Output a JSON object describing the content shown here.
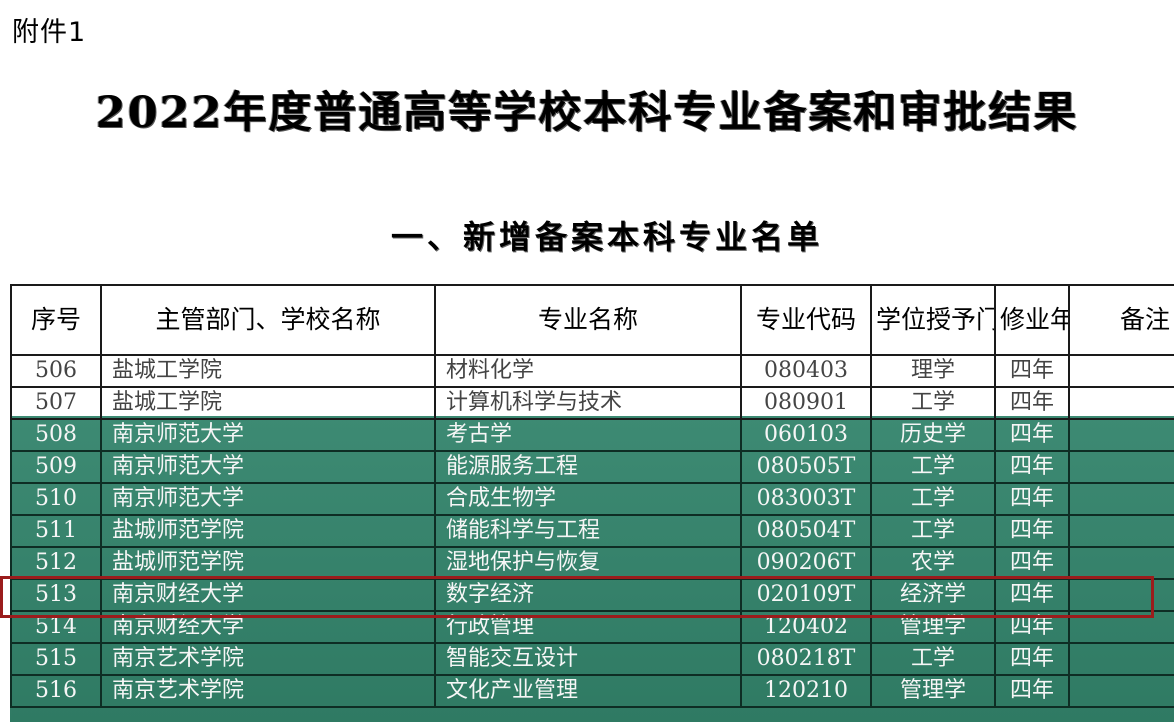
{
  "document": {
    "attachment_label": "附件1",
    "title": "2022年度普通高等学校本科专业备案和审批结果",
    "section_title": "一、新增备案本科专业名单"
  },
  "table": {
    "headers": [
      "序号",
      "主管部门、学校名称",
      "专业名称",
      "专业代码",
      "学位授予门类",
      "修业年限",
      "备注"
    ],
    "rows": [
      {
        "no": "506",
        "school": "盐城工学院",
        "major": "材料化学",
        "code": "080403",
        "degree": "理学",
        "years": "四年",
        "note": ""
      },
      {
        "no": "507",
        "school": "盐城工学院",
        "major": "计算机科学与技术",
        "code": "080901",
        "degree": "工学",
        "years": "四年",
        "note": ""
      },
      {
        "no": "508",
        "school": "南京师范大学",
        "major": "考古学",
        "code": "060103",
        "degree": "历史学",
        "years": "四年",
        "note": ""
      },
      {
        "no": "509",
        "school": "南京师范大学",
        "major": "能源服务工程",
        "code": "080505T",
        "degree": "工学",
        "years": "四年",
        "note": ""
      },
      {
        "no": "510",
        "school": "南京师范大学",
        "major": "合成生物学",
        "code": "083003T",
        "degree": "工学",
        "years": "四年",
        "note": ""
      },
      {
        "no": "511",
        "school": "盐城师范学院",
        "major": "储能科学与工程",
        "code": "080504T",
        "degree": "工学",
        "years": "四年",
        "note": ""
      },
      {
        "no": "512",
        "school": "盐城师范学院",
        "major": "湿地保护与恢复",
        "code": "090206T",
        "degree": "农学",
        "years": "四年",
        "note": ""
      },
      {
        "no": "513",
        "school": "南京财经大学",
        "major": "数字经济",
        "code": "020109T",
        "degree": "经济学",
        "years": "四年",
        "note": ""
      },
      {
        "no": "514",
        "school": "南京财经大学",
        "major": "行政管理",
        "code": "120402",
        "degree": "管理学",
        "years": "四年",
        "note": ""
      },
      {
        "no": "515",
        "school": "南京艺术学院",
        "major": "智能交互设计",
        "code": "080218T",
        "degree": "工学",
        "years": "四年",
        "note": ""
      },
      {
        "no": "516",
        "school": "南京艺术学院",
        "major": "文化产业管理",
        "code": "120210",
        "degree": "管理学",
        "years": "四年",
        "note": ""
      }
    ],
    "highlighted_row": "513"
  }
}
